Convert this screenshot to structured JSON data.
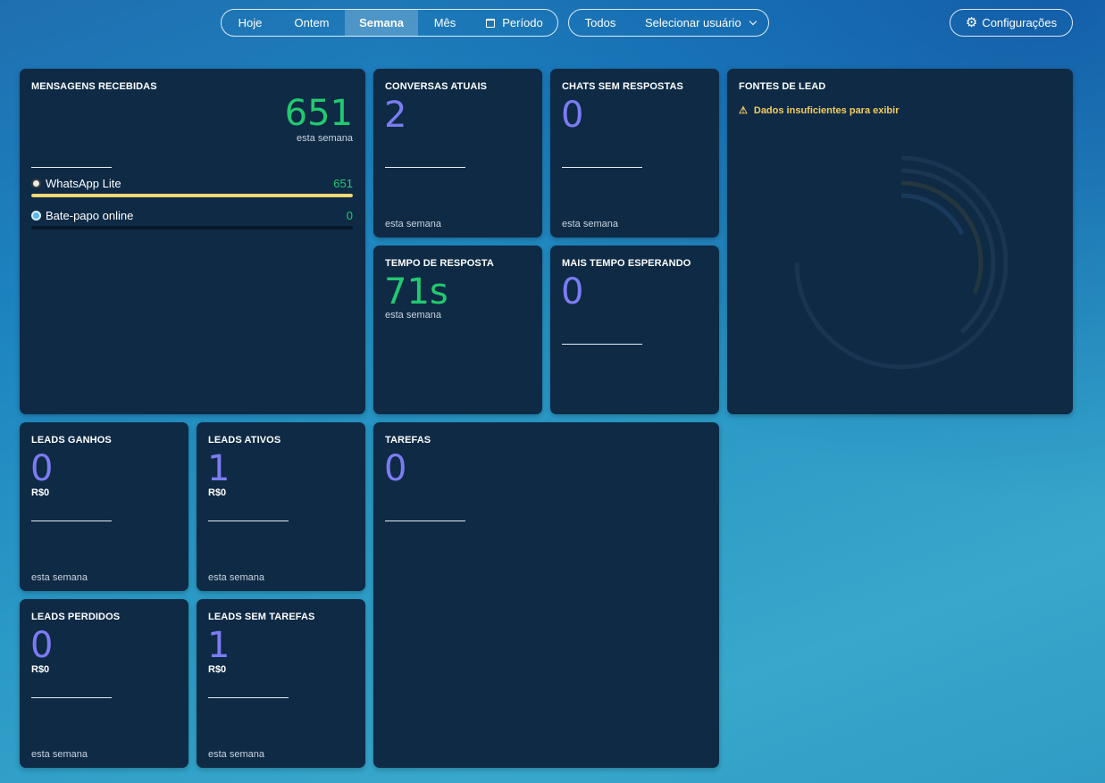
{
  "toolbar": {
    "periods": [
      "Hoje",
      "Ontem",
      "Semana",
      "Mês",
      "Período"
    ],
    "active_period": "Semana",
    "users_all": "Todos",
    "users_select": "Selecionar usuário",
    "settings": "Configurações"
  },
  "icons": {
    "calendar": "calendar-icon",
    "chevron": "chevron-down-icon",
    "settings": "gear-icon",
    "whatsapp": "whatsapp-icon",
    "chat": "chat-bubble-icon",
    "warning": "warning-icon"
  },
  "colors": {
    "card_bg": "#0e2a45",
    "value_blue": "#7c7cf2",
    "value_green": "#23c96f",
    "bar_yellow": "#f7d774",
    "warning": "#f6cc5b"
  },
  "messages": {
    "title": "MENSAGENS RECEBIDAS",
    "total": "651",
    "total_caption": "esta semana",
    "sources": [
      {
        "name": "WhatsApp Lite",
        "value": "651",
        "fraction": 1.0
      },
      {
        "name": "Bate-papo online",
        "value": "0",
        "fraction": 0
      }
    ]
  },
  "conversas": {
    "title": "CONVERSAS ATUAIS",
    "value": "2",
    "footer": "esta semana"
  },
  "chats_sem": {
    "title": "CHATS SEM RESPOSTAS",
    "value": "0",
    "footer": "esta semana"
  },
  "tempo_resposta": {
    "title": "TEMPO DE RESPOSTA",
    "value": "71s",
    "caption": "esta semana"
  },
  "mais_tempo": {
    "title": "MAIS TEMPO ESPERANDO",
    "value": "0"
  },
  "fontes": {
    "title": "FONTES DE LEAD",
    "warning": "Dados insuficientes para exibir"
  },
  "leads_ganhos": {
    "title": "LEADS GANHOS",
    "value": "0",
    "money": "R$0",
    "footer": "esta semana"
  },
  "leads_ativos": {
    "title": "LEADS ATIVOS",
    "value": "1",
    "money": "R$0",
    "footer": "esta semana"
  },
  "leads_perdidos": {
    "title": "LEADS PERDIDOS",
    "value": "0",
    "money": "R$0",
    "footer": "esta semana"
  },
  "leads_sem_tarefas": {
    "title": "LEADS SEM TAREFAS",
    "value": "1",
    "money": "R$0",
    "footer": "esta semana"
  },
  "tarefas": {
    "title": "TAREFAS",
    "value": "0"
  }
}
